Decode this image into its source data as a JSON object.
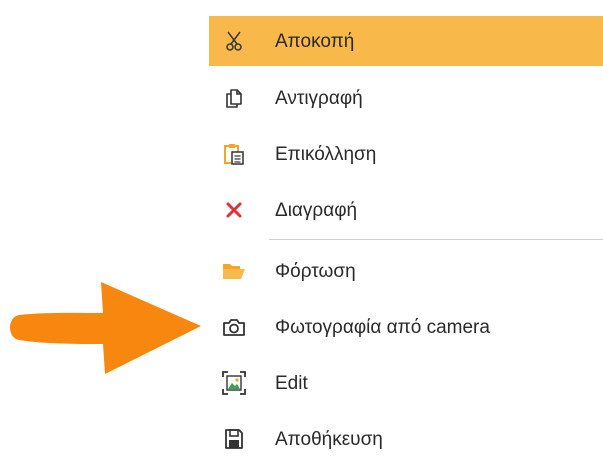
{
  "context_menu": {
    "items": [
      {
        "label": "Αποκοπή",
        "icon": "scissors-icon",
        "highlighted": true
      },
      {
        "label": "Αντιγραφή",
        "icon": "copy-icon"
      },
      {
        "label": "Επικόλληση",
        "icon": "paste-icon"
      },
      {
        "label": "Διαγραφή",
        "icon": "delete-x-icon"
      },
      {
        "label": "Φόρτωση",
        "icon": "folder-open-icon"
      },
      {
        "label": "Φωτογραφία από camera",
        "icon": "camera-icon"
      },
      {
        "label": "Edit",
        "icon": "image-edit-icon"
      },
      {
        "label": "Αποθήκευση",
        "icon": "save-icon"
      }
    ]
  },
  "colors": {
    "highlight": "#f9b84a",
    "delete_red": "#e0313b",
    "folder_orange": "#f5a623",
    "arrow_orange": "#f7870f"
  }
}
